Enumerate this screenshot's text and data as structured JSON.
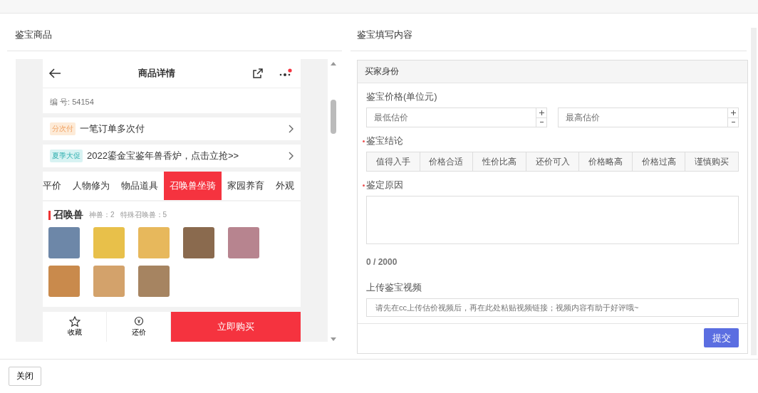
{
  "left_panel": {
    "title": "鉴宝商品"
  },
  "phone": {
    "title": "商品详情",
    "notification": true,
    "serial": "编 号: 54154",
    "promos": [
      {
        "kind": "installment",
        "tag": "分次付",
        "text": "一笔订单多次付"
      },
      {
        "kind": "sale",
        "tag": "夏季大促",
        "text": "2022鎏金宝鉴年兽香炉，点击立抢>>"
      }
    ],
    "tabs": [
      {
        "label": "平价",
        "selected": false
      },
      {
        "label": "人物修为",
        "selected": false
      },
      {
        "label": "物品道具",
        "selected": false
      },
      {
        "label": "召唤兽坐骑",
        "selected": true
      },
      {
        "label": "家园养育",
        "selected": false
      },
      {
        "label": "外观",
        "selected": false
      }
    ],
    "section": {
      "title": "召唤兽",
      "stats": [
        "神兽：2",
        "特殊召唤兽：5"
      ]
    },
    "actions": [
      {
        "kind": "star",
        "label": "收藏"
      },
      {
        "kind": "bargain",
        "label": "还价"
      }
    ],
    "buy_button": "立即购买"
  },
  "right_panel": {
    "title": "鉴宝填写内容",
    "section_header": "买家身份",
    "price": {
      "label": "鉴宝价格(单位元)",
      "fields": [
        {
          "placeholder": "最低估价"
        },
        {
          "placeholder": "最高估价"
        }
      ]
    },
    "conclusion": {
      "label": "鉴宝结论",
      "required": true,
      "options": [
        {
          "label": "值得入手",
          "selected": false
        },
        {
          "label": "价格合适",
          "selected": false
        },
        {
          "label": "性价比高",
          "selected": false
        },
        {
          "label": "还价可入",
          "selected": false
        },
        {
          "label": "价格略高",
          "selected": false
        },
        {
          "label": "价格过高",
          "selected": false
        },
        {
          "label": "谨慎购买",
          "selected": false
        }
      ]
    },
    "reason": {
      "label": "鉴定原因",
      "required": true,
      "counter": "0 / 2000"
    },
    "video": {
      "label": "上传鉴宝视频",
      "placeholder": "请先在cc上传估价视频后，再在此处粘贴视频链接；视频内容有助于好评哦~"
    },
    "submit": "提交"
  },
  "footer": {
    "close_button": "关闭"
  }
}
